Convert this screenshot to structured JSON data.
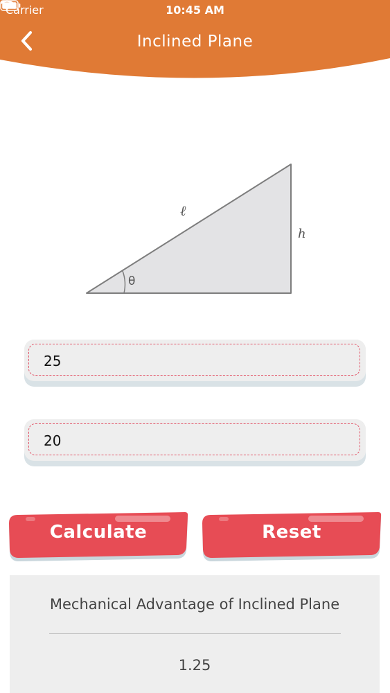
{
  "status_bar": {
    "carrier": "Carrier",
    "time": "10:45 AM"
  },
  "header": {
    "title": "Inclined Plane",
    "color": "#e07a35",
    "back_icon": "chevron-left-icon"
  },
  "diagram": {
    "length_label": "ℓ",
    "height_label": "h",
    "angle_label": "θ"
  },
  "inputs": [
    {
      "value": "25"
    },
    {
      "value": "20"
    }
  ],
  "buttons": {
    "calculate": "Calculate",
    "reset": "Reset",
    "color": "#e74c55"
  },
  "result": {
    "title": "Mechanical Advantage of Inclined Plane",
    "value": "1.25"
  }
}
